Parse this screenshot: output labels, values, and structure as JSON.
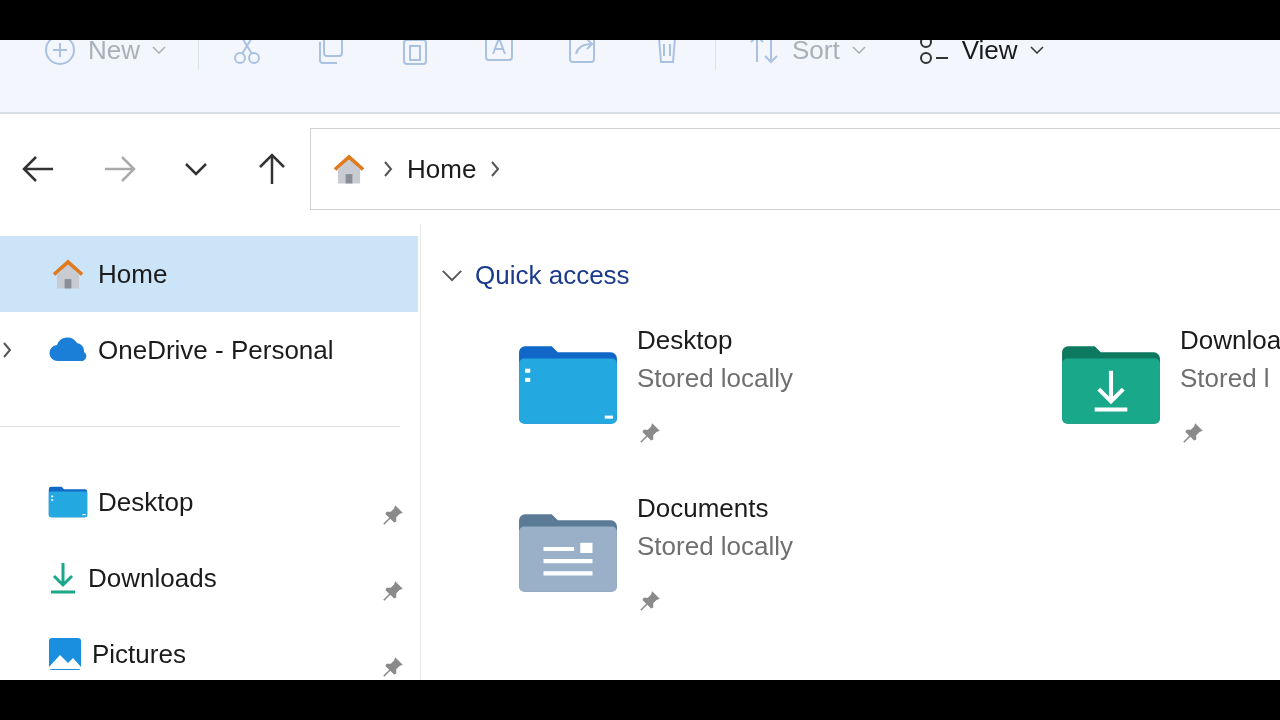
{
  "toolbar": [
    {
      "kind": "new",
      "label": "New",
      "disabled": true
    },
    {
      "kind": "cut",
      "disabled": true
    },
    {
      "kind": "copy",
      "disabled": true
    },
    {
      "kind": "paste",
      "disabled": true
    },
    {
      "kind": "rename",
      "disabled": true
    },
    {
      "kind": "share",
      "disabled": true
    },
    {
      "kind": "delete",
      "disabled": true
    },
    {
      "kind": "sort",
      "label": "Sort",
      "disabled": true
    },
    {
      "kind": "view",
      "label": "View",
      "disabled": false
    }
  ],
  "navigation": {
    "back_disabled": false,
    "forward_disabled": true
  },
  "address_bar": {
    "path": [
      "Home"
    ]
  },
  "sidebar": {
    "items": [
      {
        "kind": "home",
        "label": "Home",
        "selected": true,
        "pinned": false,
        "expandable": false
      },
      {
        "kind": "onedrive",
        "label": "OneDrive - Personal",
        "selected": false,
        "pinned": false,
        "expandable": true
      },
      {
        "kind": "divider"
      },
      {
        "kind": "desktop",
        "label": "Desktop",
        "selected": false,
        "pinned": true,
        "expandable": false
      },
      {
        "kind": "downloads",
        "label": "Downloads",
        "selected": false,
        "pinned": true,
        "expandable": false
      },
      {
        "kind": "pictures",
        "label": "Pictures",
        "selected": false,
        "pinned": true,
        "expandable": false
      }
    ]
  },
  "quick_access": {
    "title": "Quick access",
    "expanded": true,
    "items": [
      {
        "kind": "desktop",
        "name": "Desktop",
        "status": "Stored locally",
        "pinned": true
      },
      {
        "kind": "downloads",
        "name": "Downloa",
        "status": "Stored l",
        "pinned": true
      },
      {
        "kind": "documents",
        "name": "Documents",
        "status": "Stored locally",
        "pinned": true
      }
    ]
  }
}
